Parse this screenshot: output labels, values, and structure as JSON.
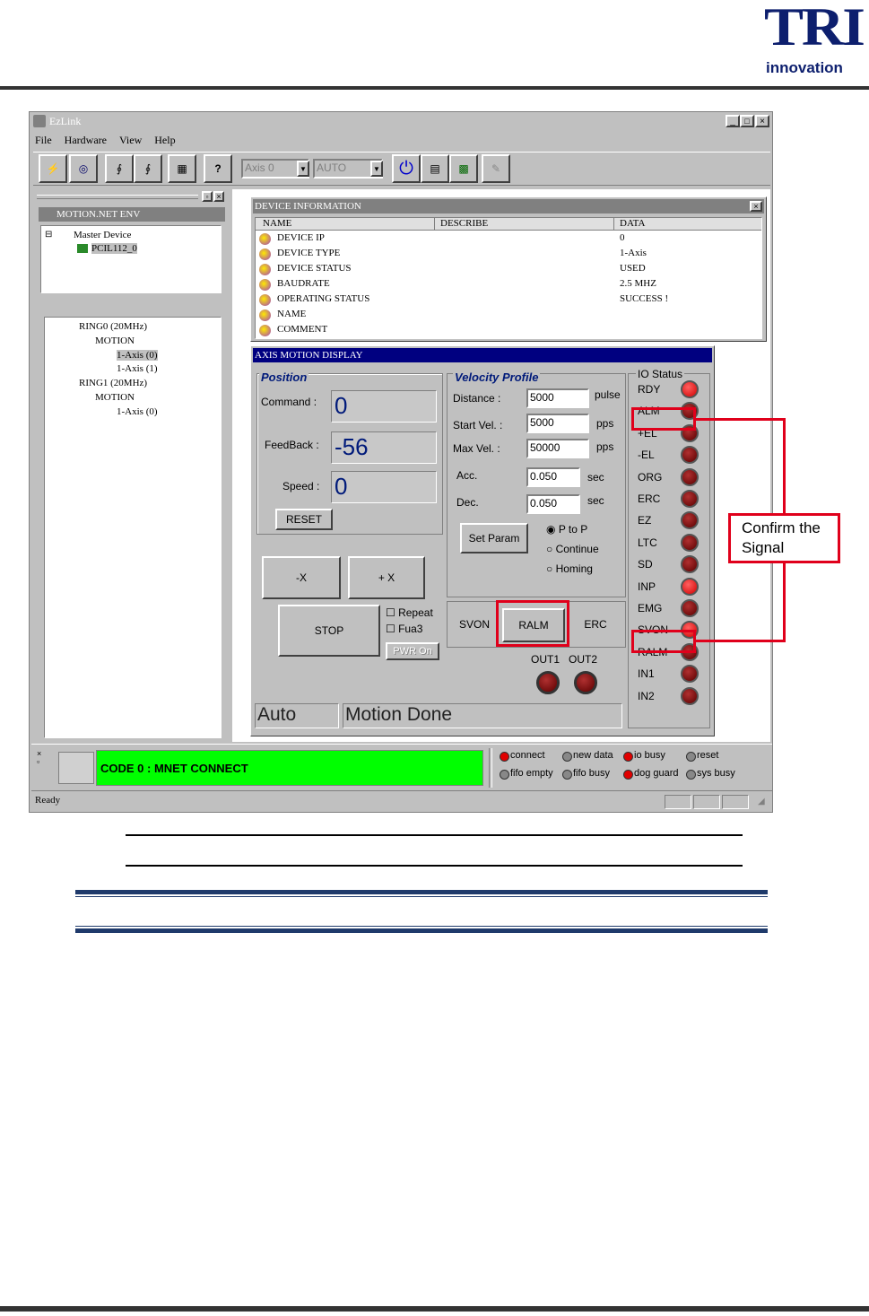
{
  "logo": {
    "main": "TRI",
    "sub": "innovation"
  },
  "window": {
    "title": "EzLink"
  },
  "menu": [
    "File",
    "Hardware",
    "View",
    "Help"
  ],
  "toolbar": {
    "axis_select": "Axis 0",
    "mode_select": "AUTO"
  },
  "left_panel": {
    "header": "MOTION.NET ENV",
    "tree1": {
      "root": "Master Device",
      "child": "PCIL112_0"
    },
    "tree2": [
      {
        "label": "RING0 (20MHz)"
      },
      {
        "label": "MOTION"
      },
      {
        "label": "1-Axis (0)"
      },
      {
        "label": "1-Axis (1)"
      },
      {
        "label": "RING1 (20MHz)"
      },
      {
        "label": "MOTION"
      },
      {
        "label": "1-Axis (0)"
      }
    ]
  },
  "device_info": {
    "title": "DEVICE INFORMATION",
    "columns": [
      "NAME",
      "DESCRIBE",
      "DATA"
    ],
    "rows": [
      {
        "name": "DEVICE IP",
        "describe": "",
        "data": "0"
      },
      {
        "name": "DEVICE TYPE",
        "describe": "",
        "data": "1-Axis"
      },
      {
        "name": "DEVICE STATUS",
        "describe": "",
        "data": "USED"
      },
      {
        "name": "BAUDRATE",
        "describe": "",
        "data": "2.5 MHZ"
      },
      {
        "name": "OPERATING STATUS",
        "describe": "",
        "data": "SUCCESS !"
      },
      {
        "name": "NAME",
        "describe": "",
        "data": ""
      },
      {
        "name": "COMMENT",
        "describe": "",
        "data": ""
      }
    ]
  },
  "axis_display": {
    "title": "AXIS MOTION DISPLAY",
    "position": {
      "title": "Position",
      "command_label": "Command :",
      "command": "0",
      "feedback_label": "FeedBack :",
      "feedback": "-56",
      "speed_label": "Speed :",
      "speed": "0",
      "reset": "RESET"
    },
    "velocity": {
      "title": "Velocity Profile",
      "distance_label": "Distance :",
      "distance": "5000",
      "distance_unit": "pulse",
      "start_label": "Start Vel. :",
      "start": "5000",
      "start_unit": "pps",
      "max_label": "Max Vel. :",
      "max": "50000",
      "max_unit": "pps",
      "acc_label": "Acc.",
      "acc": "0.050",
      "acc_unit": "sec",
      "dec_label": "Dec.",
      "dec": "0.050",
      "dec_unit": "sec",
      "set_param": "Set Param",
      "modes": [
        "P to P",
        "Continue",
        "Homing"
      ]
    },
    "jog": {
      "minus": "-X",
      "plus": "+ X",
      "stop": "STOP",
      "repeat": "Repeat",
      "fua3": "Fua3",
      "pwr": "PWR On"
    },
    "controls": {
      "svon": "SVON",
      "ralm": "RALM",
      "erc": "ERC",
      "out1": "OUT1",
      "out2": "OUT2"
    },
    "status_left": "Auto",
    "status_right": "Motion Done",
    "io": {
      "title": "IO Status",
      "signals": [
        {
          "label": "RDY",
          "on": true
        },
        {
          "label": "ALM",
          "on": false
        },
        {
          "label": "+EL",
          "on": false
        },
        {
          "label": "-EL",
          "on": false
        },
        {
          "label": "ORG",
          "on": false
        },
        {
          "label": "ERC",
          "on": false
        },
        {
          "label": "EZ",
          "on": false
        },
        {
          "label": "LTC",
          "on": false
        },
        {
          "label": "SD",
          "on": false
        },
        {
          "label": "INP",
          "on": true
        },
        {
          "label": "EMG",
          "on": false
        },
        {
          "label": "SVON",
          "on": true
        },
        {
          "label": "RALM",
          "on": false
        },
        {
          "label": "IN1",
          "on": false
        },
        {
          "label": "IN2",
          "on": false
        }
      ]
    }
  },
  "bottom": {
    "code": "CODE 0 : MNET CONNECT",
    "indicators": [
      {
        "label": "connect",
        "on": true
      },
      {
        "label": "new data",
        "on": false
      },
      {
        "label": "io busy",
        "on": true
      },
      {
        "label": "reset",
        "on": false
      },
      {
        "label": "fifo empty",
        "on": false
      },
      {
        "label": "fifo busy",
        "on": false
      },
      {
        "label": "dog guard",
        "on": true
      },
      {
        "label": "sys busy",
        "on": false
      }
    ],
    "status": "Ready"
  },
  "callout": "Confirm the Signal",
  "colors": {
    "title_bar": "#000080",
    "highlight": "#e0001b",
    "code_bg": "#00ff00",
    "doc_rule": "#1f3a6b"
  }
}
